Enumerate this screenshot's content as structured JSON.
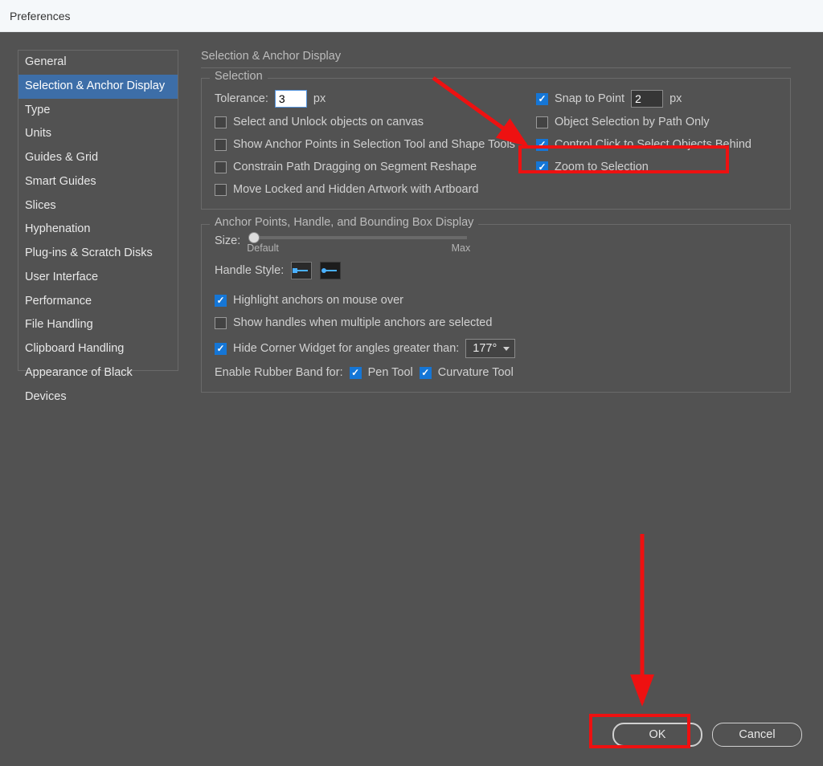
{
  "window": {
    "title": "Preferences"
  },
  "sidebar": {
    "items": [
      {
        "label": "General"
      },
      {
        "label": "Selection & Anchor Display",
        "selected": true
      },
      {
        "label": "Type"
      },
      {
        "label": "Units"
      },
      {
        "label": "Guides & Grid"
      },
      {
        "label": "Smart Guides"
      },
      {
        "label": "Slices"
      },
      {
        "label": "Hyphenation"
      },
      {
        "label": "Plug-ins & Scratch Disks"
      },
      {
        "label": "User Interface"
      },
      {
        "label": "Performance"
      },
      {
        "label": "File Handling"
      },
      {
        "label": "Clipboard Handling"
      },
      {
        "label": "Appearance of Black"
      },
      {
        "label": "Devices"
      }
    ]
  },
  "panel": {
    "title": "Selection & Anchor Display",
    "selection": {
      "group_title": "Selection",
      "tolerance_label": "Tolerance:",
      "tolerance_value": "3",
      "tolerance_unit": "px",
      "snap_label": "Snap to Point",
      "snap_value": "2",
      "snap_unit": "px",
      "select_unlock_label": "Select and Unlock objects on canvas",
      "path_only_label": "Object Selection by Path Only",
      "show_anchors_label": "Show Anchor Points in Selection Tool and Shape Tools",
      "ctrl_click_label": "Control Click to Select Objects Behind",
      "constrain_label": "Constrain Path Dragging on Segment Reshape",
      "zoom_sel_label": "Zoom to Selection",
      "move_locked_label": "Move Locked and Hidden Artwork with Artboard"
    },
    "anchors": {
      "group_title": "Anchor Points, Handle, and Bounding Box Display",
      "size_label": "Size:",
      "size_min": "Default",
      "size_max": "Max",
      "handle_style_label": "Handle Style:",
      "highlight_label": "Highlight anchors on mouse over",
      "show_handles_label": "Show handles when multiple anchors are selected",
      "hide_corner_label": "Hide Corner Widget for angles greater than:",
      "hide_corner_value": "177°",
      "rubber_band_label": "Enable Rubber Band for:",
      "pen_tool_label": "Pen Tool",
      "curv_tool_label": "Curvature Tool"
    }
  },
  "footer": {
    "ok": "OK",
    "cancel": "Cancel"
  }
}
